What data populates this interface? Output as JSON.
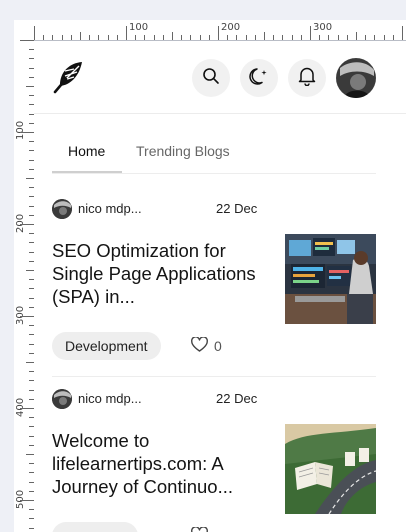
{
  "ruler": {
    "top_labels": [
      "100",
      "200",
      "300"
    ],
    "left_labels": [
      "100",
      "200",
      "300",
      "400",
      "500"
    ]
  },
  "header": {
    "logo_icon": "feather-icon",
    "buttons": [
      {
        "icon": "search-icon"
      },
      {
        "icon": "moon-sparkle-icon"
      },
      {
        "icon": "bell-icon"
      }
    ],
    "profile_avatar": "user-avatar"
  },
  "tabs": [
    {
      "label": "Home",
      "active": true
    },
    {
      "label": "Trending Blogs",
      "active": false
    }
  ],
  "posts": [
    {
      "author": "nico mdp...",
      "date": "22 Dec",
      "title": "SEO Optimization for Single Page Applications (SPA) in...",
      "tag": "Development",
      "likes": "0",
      "thumbnail": "person-at-computer-with-seo-dashboards"
    },
    {
      "author": "nico mdp...",
      "date": "22 Dec",
      "title": "Welcome to lifelearnertips.com: A Journey of Continuo...",
      "thumbnail": "open-book-on-road-landscape"
    }
  ],
  "colors": {
    "background": "#eef0f6",
    "page": "#ffffff",
    "tag_bg": "#eeeeee",
    "icon_button_bg": "#f1f1f1"
  }
}
